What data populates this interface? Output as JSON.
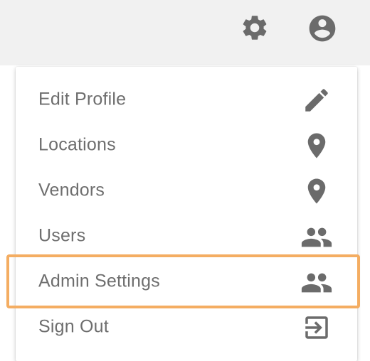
{
  "header": {
    "settings_icon": "gear-icon",
    "account_icon": "account-circle-icon"
  },
  "menu": {
    "items": [
      {
        "label": "Edit Profile",
        "icon": "pencil-icon"
      },
      {
        "label": "Locations",
        "icon": "location-pin-icon"
      },
      {
        "label": "Vendors",
        "icon": "location-pin-icon"
      },
      {
        "label": "Users",
        "icon": "people-icon"
      },
      {
        "label": "Admin Settings",
        "icon": "people-icon",
        "highlighted": true
      },
      {
        "label": "Sign Out",
        "icon": "sign-out-icon"
      }
    ]
  },
  "colors": {
    "icon": "#6b6b6b",
    "text": "#6e6e6e",
    "highlight": "#f4ad62",
    "topbar": "#f1f1f1"
  }
}
